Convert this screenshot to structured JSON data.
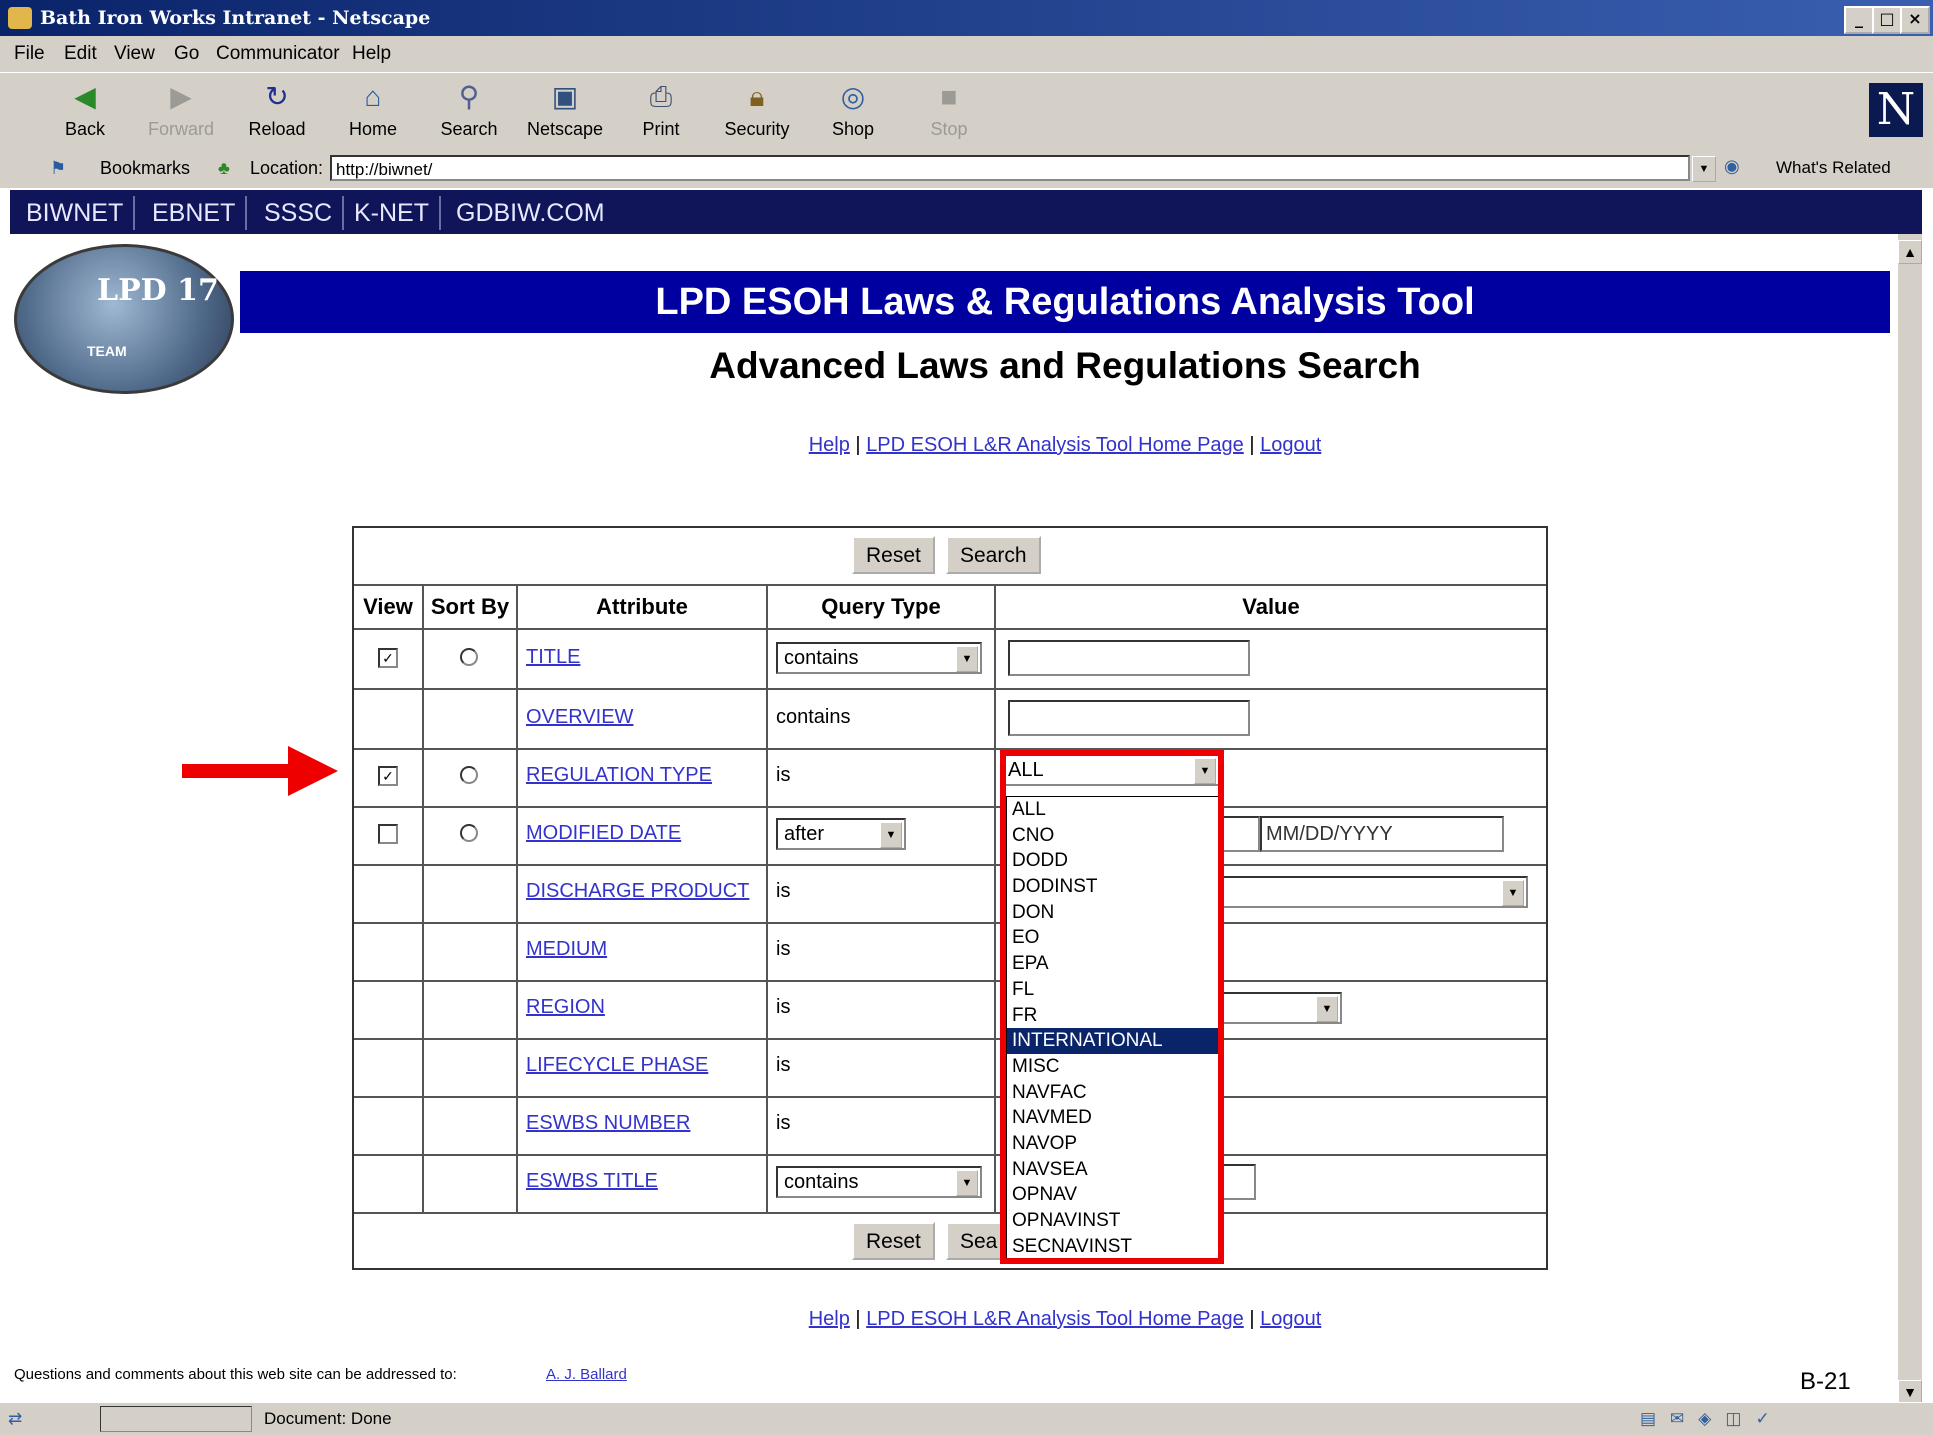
{
  "window": {
    "title": "Bath Iron Works Intranet - Netscape",
    "min_glyph": "_",
    "max_glyph": "□",
    "close_glyph": "×"
  },
  "menu": [
    "File",
    "Edit",
    "View",
    "Go",
    "Communicator",
    "Help"
  ],
  "toolbar": {
    "back": "Back",
    "forward": "Forward",
    "reload": "Reload",
    "home": "Home",
    "search": "Search",
    "netscape": "Netscape",
    "print": "Print",
    "security": "Security",
    "shop": "Shop",
    "stop": "Stop",
    "brand": "N"
  },
  "location": {
    "bookmarks": "Bookmarks",
    "label": "Location:",
    "url": "http://biwnet/",
    "whats_related": "What's Related"
  },
  "site_nav": [
    "BIWNET",
    "EBNET",
    "SSSC",
    "K-NET",
    "GDBIW.COM"
  ],
  "page": {
    "logo_text": "LPD 17",
    "logo_sub": "TEAM",
    "banner": "LPD ESOH Laws & Regulations Analysis Tool",
    "subtitle": "Advanced Laws and Regulations Search",
    "links": {
      "help": "Help",
      "sep": " | ",
      "home": "LPD ESOH L&R Analysis Tool Home Page",
      "logout": "Logout"
    }
  },
  "form": {
    "reset": "Reset",
    "search": "Search",
    "search_partial": "Sea",
    "headers": {
      "view": "View",
      "sort": "Sort By",
      "attribute": "Attribute",
      "query": "Query Type",
      "value": "Value"
    },
    "rows": {
      "title": {
        "attribute": "TITLE",
        "query": "contains"
      },
      "overview": {
        "attribute": "OVERVIEW",
        "query": "contains"
      },
      "reg_type": {
        "attribute": "REGULATION TYPE",
        "query": "is",
        "value": "ALL"
      },
      "modified": {
        "attribute": "MODIFIED DATE",
        "query": "after",
        "date_placeholder": "MM/DD/YYYY"
      },
      "discharge": {
        "attribute": "DISCHARGE PRODUCT",
        "query": "is"
      },
      "medium": {
        "attribute": "MEDIUM",
        "query": "is"
      },
      "region": {
        "attribute": "REGION",
        "query": "is"
      },
      "lifecycle": {
        "attribute": "LIFECYCLE PHASE",
        "query": "is"
      },
      "eswbs_num": {
        "attribute": "ESWBS NUMBER",
        "query": "is"
      },
      "eswbs_title": {
        "attribute": "ESWBS TITLE",
        "query": "contains"
      }
    },
    "checkbox_mark": "✓",
    "dropdown_options": [
      "ALL",
      "CNO",
      "DODD",
      "DODINST",
      "DON",
      "EO",
      "EPA",
      "FL",
      "FR",
      "INTERNATIONAL",
      "MISC",
      "NAVFAC",
      "NAVMED",
      "NAVOP",
      "NAVSEA",
      "OPNAV",
      "OPNAVINST",
      "SECNAVINST"
    ],
    "dropdown_selected": "INTERNATIONAL"
  },
  "footer": {
    "note": "Questions and comments about this web site can be addressed to:",
    "contact": "A. J. Ballard",
    "page_label": "B-21"
  },
  "status": {
    "text": "Document: Done"
  },
  "colors": {
    "banner": "#0000a0",
    "nav": "#10155a",
    "highlight_box": "#ee0000",
    "arrow": "#ee0000"
  }
}
